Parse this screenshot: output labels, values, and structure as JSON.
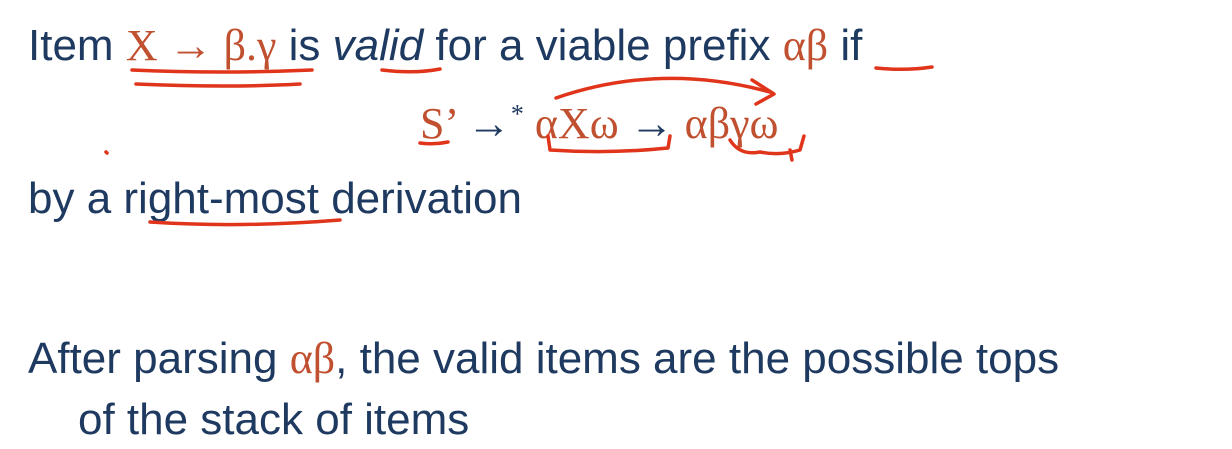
{
  "definition": {
    "word_item": "Item",
    "item_math": "X → β.γ",
    "word_is": "is",
    "word_valid": "valid",
    "text_for_prefix": "for a viable prefix",
    "prefix_math": "αβ",
    "word_if": "if"
  },
  "derivation": {
    "start_symbol": "S’",
    "star_arrow": "→",
    "star": "*",
    "sentential_1": "αXω",
    "arrow": "→",
    "sentential_2": "αβγω"
  },
  "by_line": {
    "text": "by a right-most derivation"
  },
  "after": {
    "lead": "After parsing",
    "prefix_math": "αβ",
    "rest_line1": ", the valid items are the possible tops",
    "line2": "of the stack of items"
  },
  "annotation_color": "#e0341b",
  "text_color": "#1f3a60",
  "math_color": "#c0502f"
}
